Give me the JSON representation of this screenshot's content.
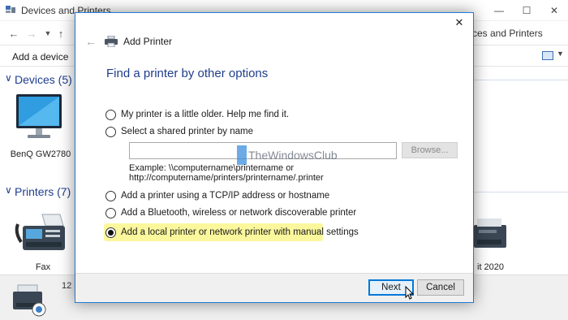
{
  "window": {
    "title": "Devices and Printers",
    "address": "ces and Printers"
  },
  "toolbar": {
    "add_device": "Add a device"
  },
  "sections": {
    "devices": {
      "label": "Devices (5)"
    },
    "printers": {
      "label": "Printers (7)"
    }
  },
  "devices": {
    "monitor_label": "BenQ GW2780",
    "fax_label": "Fax",
    "printer_right_label": "it 2020"
  },
  "status": {
    "count": "12"
  },
  "dialog": {
    "title": "Add Printer",
    "heading": "Find a printer by other options",
    "options": [
      {
        "label": "My printer is a little older. Help me find it.",
        "checked": false
      },
      {
        "label": "Select a shared printer by name",
        "checked": false
      },
      {
        "label": "Add a printer using a TCP/IP address or hostname",
        "checked": false
      },
      {
        "label": "Add a Bluetooth, wireless or network discoverable printer",
        "checked": false
      },
      {
        "label": "Add a local printer or network printer with manual settings",
        "checked": true
      }
    ],
    "shared_input_value": "",
    "browse_label": "Browse...",
    "example_line1": "Example: \\\\computername\\printername or",
    "example_line2": "http://computername/printers/printername/.printer",
    "next_label": "Next",
    "cancel_label": "Cancel"
  },
  "watermark": {
    "text": "TheWindowsClub"
  },
  "colors": {
    "accent": "#0078d7",
    "heading": "#1f3d8a",
    "highlight": "#fbf79c",
    "section": "#1e3d8f"
  }
}
